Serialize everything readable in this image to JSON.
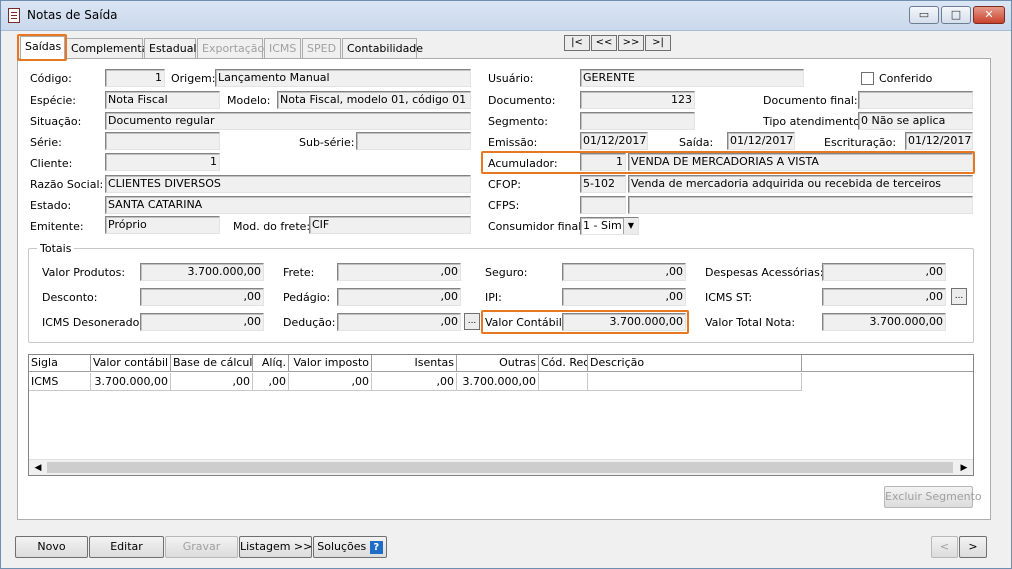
{
  "window": {
    "title": "Notas de Saída",
    "minimize": "▭",
    "maximize": "□",
    "close": "✕"
  },
  "tabs": [
    {
      "label": "Saídas",
      "state": "selected"
    },
    {
      "label": "Complementar",
      "state": "enabled"
    },
    {
      "label": "Estadual",
      "state": "enabled"
    },
    {
      "label": "Exportação",
      "state": "disabled"
    },
    {
      "label": "ICMS",
      "state": "disabled"
    },
    {
      "label": "SPED",
      "state": "disabled"
    },
    {
      "label": "Contabilidade",
      "state": "enabled"
    }
  ],
  "record_nav": {
    "first": "|<",
    "prev": "<<",
    "next": ">>",
    "last": ">|"
  },
  "left": {
    "codigo_label": "Código:",
    "codigo": "1",
    "origem_label": "Origem:",
    "origem": "Lançamento Manual",
    "especie_label": "Espécie:",
    "especie": "Nota Fiscal",
    "modelo_label": "Modelo:",
    "modelo": "Nota Fiscal, modelo 01, código 01",
    "situacao_label": "Situação:",
    "situacao": "Documento regular",
    "serie_label": "Série:",
    "serie": "",
    "subserie_label": "Sub-série:",
    "subserie": "",
    "cliente_label": "Cliente:",
    "cliente": "1",
    "razao_label": "Razão Social:",
    "razao": "CLIENTES DIVERSOS",
    "estado_label": "Estado:",
    "estado": "SANTA CATARINA",
    "emitente_label": "Emitente:",
    "emitente": "Próprio",
    "frete_label": "Mod. do frete:",
    "frete": "CIF"
  },
  "right": {
    "usuario_label": "Usuário:",
    "usuario": "GERENTE",
    "conferido_label": "Conferido",
    "documento_label": "Documento:",
    "documento": "123",
    "docfinal_label": "Documento final:",
    "docfinal": "",
    "segmento_label": "Segmento:",
    "segmento": "",
    "tipoatend_label": "Tipo atendimento:",
    "tipoatend": "0 Não se aplica",
    "emissao_label": "Emissão:",
    "emissao": "01/12/2017",
    "saida_label": "Saída:",
    "saida": "01/12/2017",
    "escrit_label": "Escrituração:",
    "escrit": "01/12/2017",
    "acumulador_label": "Acumulador:",
    "acumulador_code": "1",
    "acumulador_desc": "VENDA DE MERCADORIAS A VISTA",
    "cfop_label": "CFOP:",
    "cfop_code": "5-102",
    "cfop_desc": "Venda de mercadoria adquirida ou recebida de terceiros",
    "cfps_label": "CFPS:",
    "cfps_code": "",
    "cfps_desc": "",
    "consumidor_label": "Consumidor final:",
    "consumidor": "1 - Sim"
  },
  "totais": {
    "title": "Totais",
    "valor_produtos_label": "Valor Produtos:",
    "valor_produtos": "3.700.000,00",
    "desconto_label": "Desconto:",
    "desconto": ",00",
    "icms_deson_label": "ICMS Desonerado:",
    "icms_deson": ",00",
    "frete_label": "Frete:",
    "frete": ",00",
    "pedagio_label": "Pedágio:",
    "pedagio": ",00",
    "deducao_label": "Dedução:",
    "deducao": ",00",
    "seguro_label": "Seguro:",
    "seguro": ",00",
    "ipi_label": "IPI:",
    "ipi": ",00",
    "valor_contabil_label": "Valor Contábil:",
    "valor_contabil": "3.700.000,00",
    "despesas_label": "Despesas Acessórias:",
    "despesas": ",00",
    "icms_st_label": "ICMS ST:",
    "icms_st": ",00",
    "valor_total_label": "Valor Total Nota:",
    "valor_total": "3.700.000,00",
    "ellipsis": "..."
  },
  "grid": {
    "columns": [
      "Sigla",
      "Valor contábil",
      "Base de cálculo",
      "Alíq.",
      "Valor imposto",
      "Isentas",
      "Outras",
      "Cód. Rec.",
      "Descrição"
    ],
    "rows": [
      [
        "ICMS",
        "3.700.000,00",
        ",00",
        ",00",
        ",00",
        ",00",
        "3.700.000,00",
        "",
        ""
      ]
    ]
  },
  "excluir_segmento": "Excluir Segmento",
  "bottom": {
    "novo": "Novo",
    "editar": "Editar",
    "gravar": "Gravar",
    "listagem": "Listagem >>",
    "solucoes": "Soluções",
    "help": "?",
    "prev": "<",
    "next": ">"
  },
  "colors": {
    "highlight": "#e87722",
    "title_bar": "#c9d8ec"
  }
}
